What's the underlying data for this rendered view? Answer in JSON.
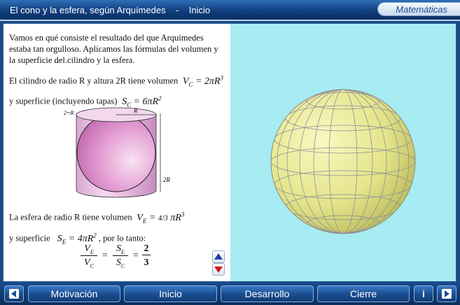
{
  "header": {
    "title": "El cono y la esfera, según Arquímedes    -    Inicio",
    "subject": "Matemáticas"
  },
  "text": {
    "intro": "Vamos en qué consiste el resultado del que Arquímedes estaba tan orgulloso. Aplicamos las fórmulas del volumen y la superficie del.cilindro y la esfera.",
    "cyl_volume_text": "El cilindro de radio R y altura 2R tiene volumen",
    "cyl_volume_formula": "V_C = 2πR^3",
    "cyl_surface_text": "y superficie (incluyendo tapas)",
    "cyl_surface_formula": "S_C = 6πR^2",
    "sph_volume_text": "La esfera de radio R tiene volumen",
    "sph_volume_formula": "V_E = 4/3 πR^3",
    "sph_surface_text": "y superficie",
    "sph_surface_formula": "S_E = 4πR^2",
    "sph_surface_suffix": ", por lo tanto:",
    "ratio_formula": "V_E/V_C = S_E/S_C = 2/3"
  },
  "figure": {
    "diameter_label": "2=R",
    "radius_label": "R",
    "height_label": "2R"
  },
  "nav": {
    "motivacion": "Motivación",
    "inicio": "Inicio",
    "desarrollo": "Desarrollo",
    "cierre": "Cierre",
    "info": "i"
  },
  "icons": [
    "left-arrow-icon",
    "right-arrow-icon",
    "up-arrow-icon",
    "down-arrow-icon",
    "info-icon"
  ],
  "colors": {
    "accent": "#1b4f93",
    "viewer_bg": "#a7ecf3",
    "sphere": "#e4e48a"
  }
}
